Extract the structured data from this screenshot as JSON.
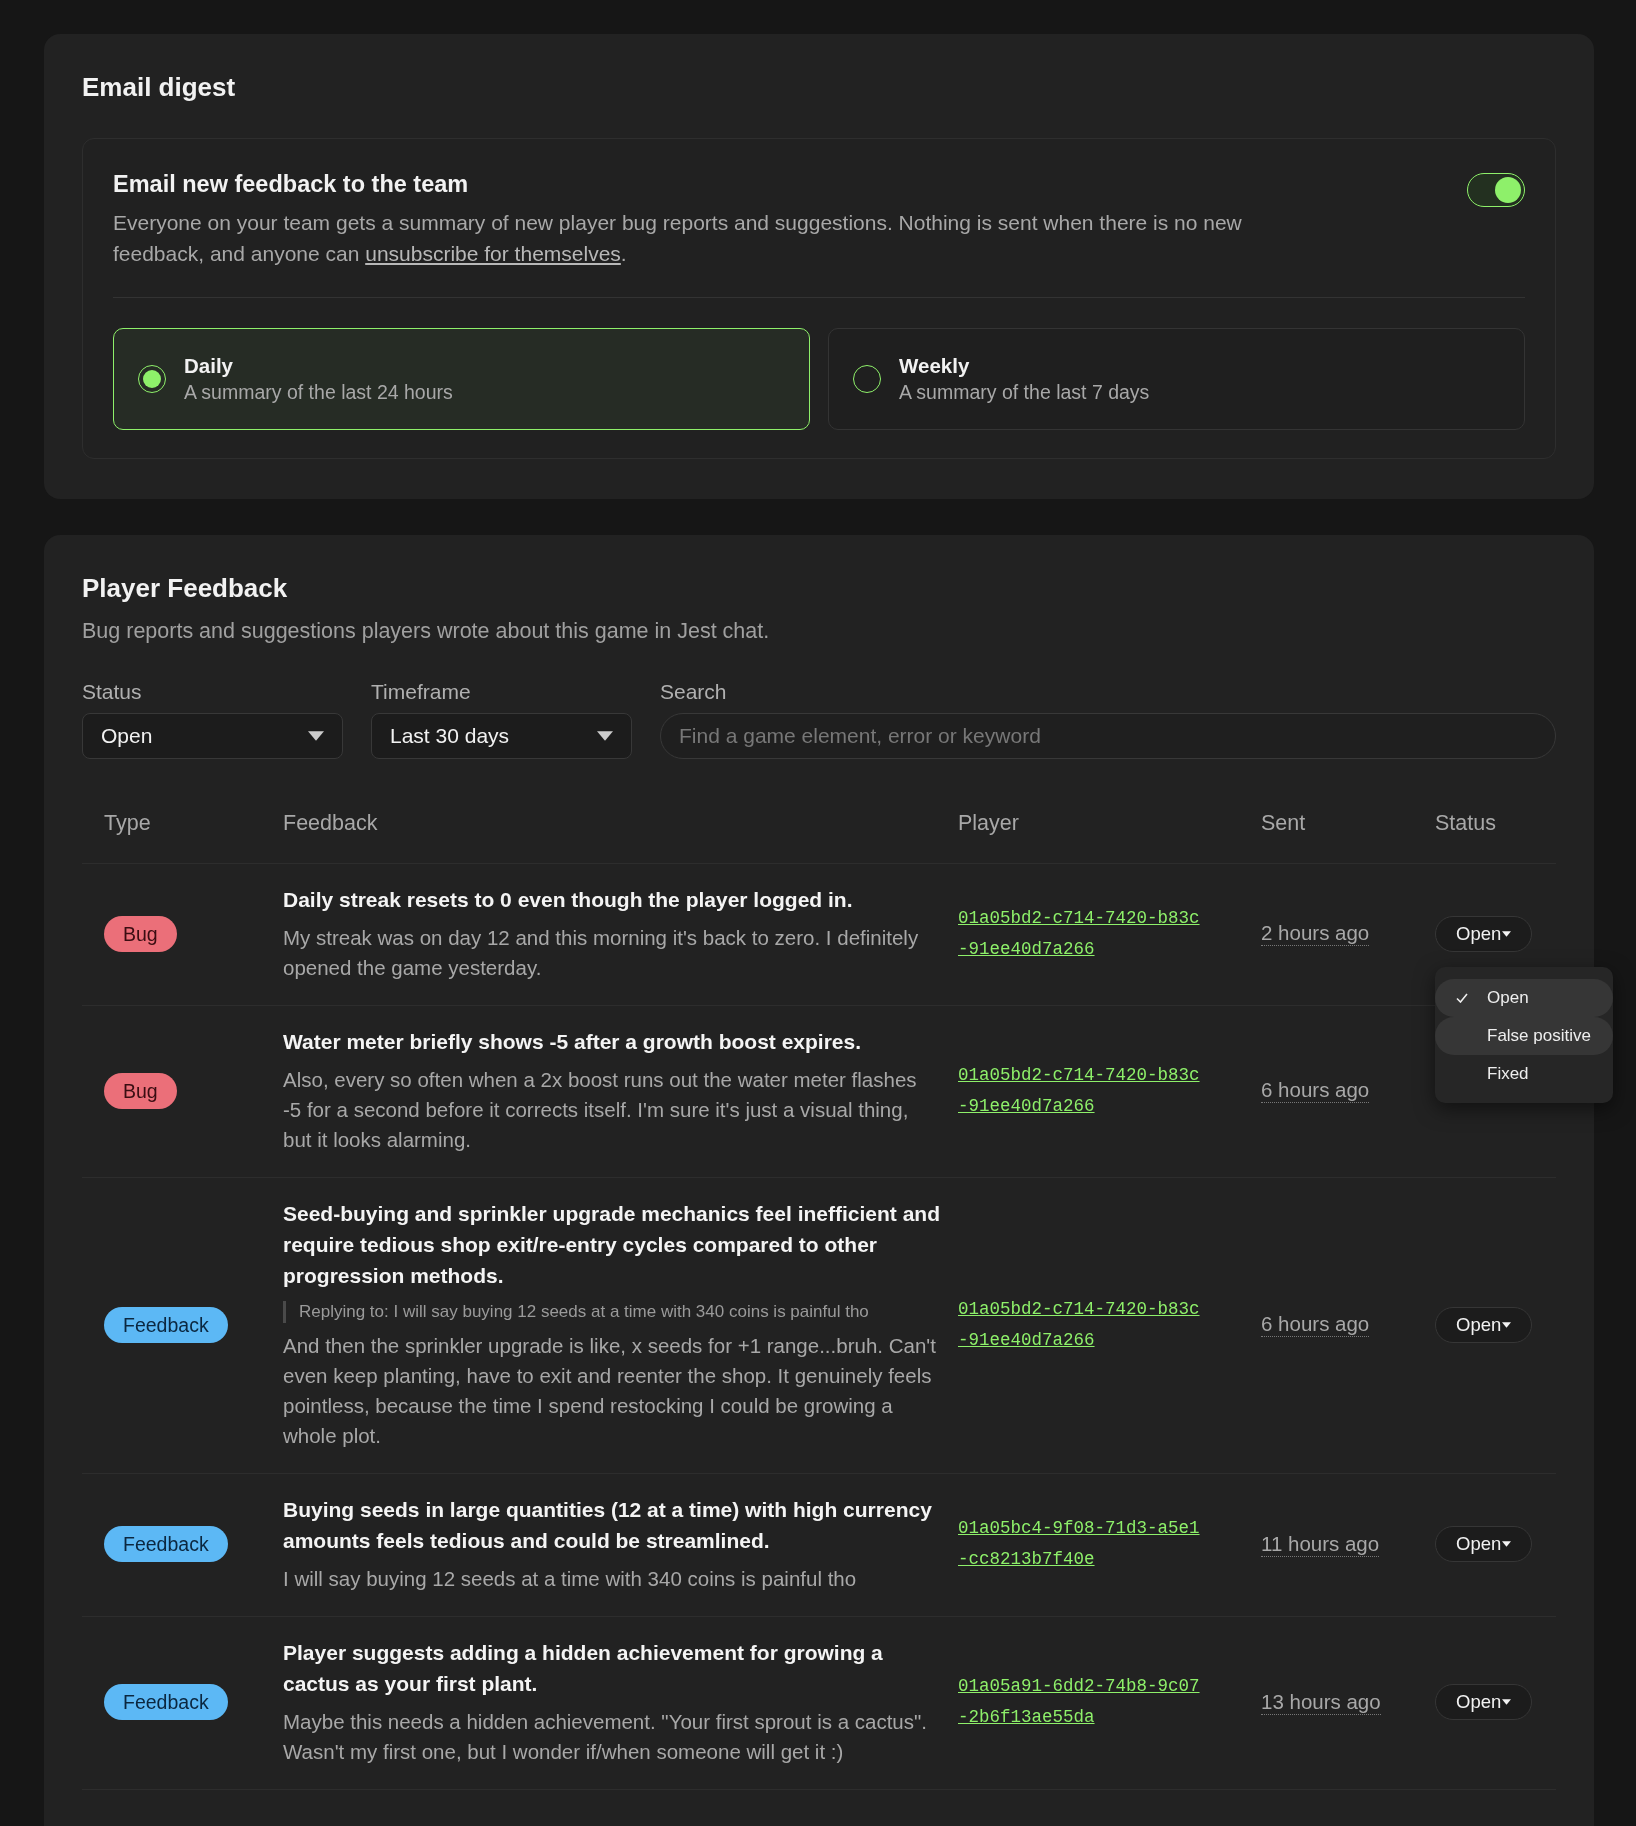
{
  "email_digest": {
    "title": "Email digest",
    "setting": {
      "title": "Email new feedback to the team",
      "description": "Everyone on your team gets a summary of new player bug reports and suggestions. Nothing is sent when there is no new feedback, and anyone can ",
      "link": "unsubscribe for themselves",
      "description_end": ".",
      "on": true
    },
    "frequency_options": [
      {
        "label": "Daily",
        "description": "A summary of the last 24 hours",
        "selected": true
      },
      {
        "label": "Weekly",
        "description": "A summary of the last 7 days",
        "selected": false
      }
    ]
  },
  "player_feedback": {
    "title": "Player Feedback",
    "subtitle": "Bug reports and suggestions players wrote about this game in Jest chat.",
    "filters": [
      {
        "kind": "select",
        "label": "Status",
        "value": "Open"
      },
      {
        "kind": "select",
        "label": "Timeframe",
        "value": "Last 30 days"
      },
      {
        "kind": "search",
        "label": "Search",
        "placeholder": "Find a game element, error or keyword"
      }
    ],
    "table": {
      "columns": [
        "Type",
        "Feedback",
        "Player",
        "Sent",
        "Status"
      ],
      "rows": [
        {
          "type": {
            "kind": "bug",
            "label": "Bug"
          },
          "title": "Daily streak resets to 0 even though the player logged in.",
          "body": "My streak was on day 12 and this morning it's back to zero. I definitely opened the game yesterday.",
          "player": "01a05bd2-c714-7420-b83c-91ee40d7a266",
          "sent": "2 hours ago",
          "status": "Open",
          "status_menu": {
            "items": [
              {
                "label": "Open",
                "selected": true,
                "highlighted": false
              },
              {
                "label": "False positive",
                "selected": false,
                "highlighted": true
              },
              {
                "label": "Fixed",
                "selected": false,
                "highlighted": false
              }
            ]
          }
        },
        {
          "type": {
            "kind": "bug",
            "label": "Bug"
          },
          "title": "Water meter briefly shows -5 after a growth boost expires.",
          "body": "Also, every so often when a 2x boost runs out the water meter flashes -5 for a second before it corrects itself. I'm sure it's just a visual thing, but it looks alarming.",
          "player": "01a05bd2-c714-7420-b83c-91ee40d7a266",
          "sent": "6 hours ago"
        },
        {
          "type": {
            "kind": "feedback",
            "label": "Feedback"
          },
          "title": "Seed-buying and sprinkler upgrade mechanics feel inefficient and require tedious shop exit/re-entry cycles compared to other progression methods.",
          "reply_to": "Replying to: I will say buying 12 seeds at a time with 340 coins is painful tho",
          "body": "And then the sprinkler upgrade is like, x seeds for +1 range...bruh. Can't even keep planting, have to exit and reenter the shop. It genuinely feels pointless, because the time I spend restocking I could be growing a whole plot.",
          "player": "01a05bd2-c714-7420-b83c-91ee40d7a266",
          "sent": "6 hours ago",
          "status": "Open"
        },
        {
          "type": {
            "kind": "feedback",
            "label": "Feedback"
          },
          "title": "Buying seeds in large quantities (12 at a time) with high currency amounts feels tedious and could be streamlined.",
          "body": "I will say buying 12 seeds at a time with 340 coins is painful tho",
          "player": "01a05bc4-9f08-71d3-a5e1-cc8213b7f40e",
          "sent": "11 hours ago",
          "status": "Open"
        },
        {
          "type": {
            "kind": "feedback",
            "label": "Feedback"
          },
          "title": "Player suggests adding a hidden achievement for growing a cactus as your first plant.",
          "body": "Maybe this needs a hidden achievement. \"Your first sprout is a cactus\". Wasn't my first one, but I wonder if/when someone will get it :)",
          "player": "01a05a91-6dd2-74b8-9c07-2b6f13ae55da",
          "sent": "13 hours ago",
          "status": "Open"
        }
      ]
    }
  }
}
